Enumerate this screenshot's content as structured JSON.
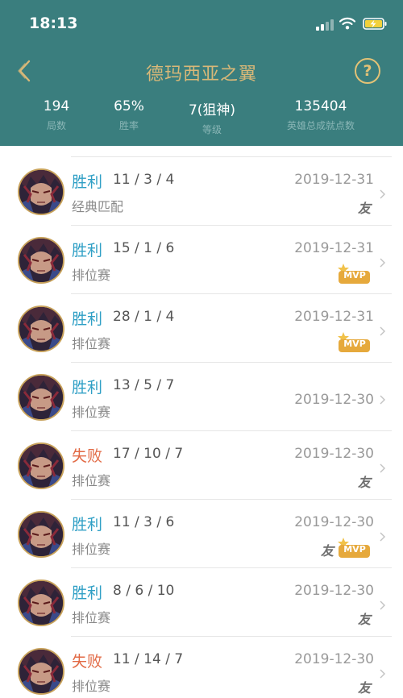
{
  "status_bar": {
    "time": "18:13"
  },
  "header": {
    "title": "德玛西亚之翼",
    "help_label": "?"
  },
  "stats": [
    {
      "value": "194",
      "label": "局数"
    },
    {
      "value": "65%",
      "label": "胜率"
    },
    {
      "value": "7(狙神)",
      "label": "等级"
    },
    {
      "value": "135404",
      "label": "英雄总成就点数"
    }
  ],
  "badge_labels": {
    "you": "友",
    "mvp": "MVP"
  },
  "colors": {
    "header_bg": "#3a7e7e",
    "win": "#2f9fc5",
    "loss": "#e26a45",
    "title": "#d9b878",
    "mvp": "#e6a93c"
  },
  "matches": [
    {
      "result": "胜利",
      "outcome": "win",
      "kda": "11 / 3 / 4",
      "mode": "经典匹配",
      "date": "2019-12-31",
      "you": true,
      "mvp": false
    },
    {
      "result": "胜利",
      "outcome": "win",
      "kda": "15 / 1 / 6",
      "mode": "排位赛",
      "date": "2019-12-31",
      "you": false,
      "mvp": true
    },
    {
      "result": "胜利",
      "outcome": "win",
      "kda": "28 / 1 / 4",
      "mode": "排位赛",
      "date": "2019-12-31",
      "you": false,
      "mvp": true
    },
    {
      "result": "胜利",
      "outcome": "win",
      "kda": "13 / 5 / 7",
      "mode": "排位赛",
      "date": "2019-12-30",
      "you": false,
      "mvp": false
    },
    {
      "result": "失败",
      "outcome": "loss",
      "kda": "17 / 10 / 7",
      "mode": "排位赛",
      "date": "2019-12-30",
      "you": true,
      "mvp": false
    },
    {
      "result": "胜利",
      "outcome": "win",
      "kda": "11 / 3 / 6",
      "mode": "排位赛",
      "date": "2019-12-30",
      "you": true,
      "mvp": true
    },
    {
      "result": "胜利",
      "outcome": "win",
      "kda": "8 / 6 / 10",
      "mode": "排位赛",
      "date": "2019-12-30",
      "you": true,
      "mvp": false
    },
    {
      "result": "失败",
      "outcome": "loss",
      "kda": "11 / 14 / 7",
      "mode": "排位赛",
      "date": "2019-12-30",
      "you": true,
      "mvp": false
    }
  ]
}
